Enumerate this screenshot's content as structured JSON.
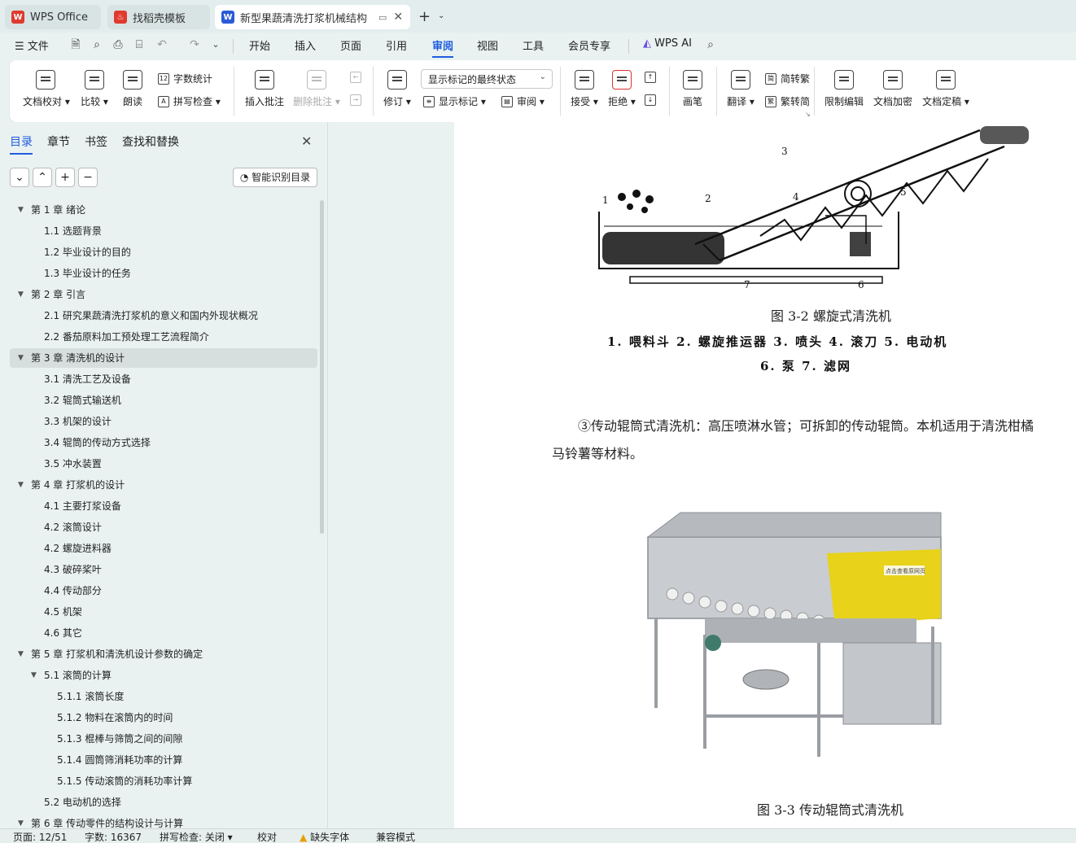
{
  "tabs": [
    {
      "label": "WPS Office",
      "icon": "wps-logo-icon",
      "color": "#e03a2f"
    },
    {
      "label": "找稻壳模板",
      "icon": "docer-icon",
      "color": "#e03a2f"
    },
    {
      "label": "新型果蔬清洗打浆机械结构",
      "icon": "writer-doc-icon",
      "color": "#2a5bd7"
    }
  ],
  "menu": {
    "file": "文件",
    "items": [
      "开始",
      "插入",
      "页面",
      "引用",
      "审阅",
      "视图",
      "工具",
      "会员专享"
    ],
    "active": "审阅",
    "ai": "WPS AI"
  },
  "ribbon": {
    "doc_check": "文档校对",
    "compare": "比较",
    "read_aloud": "朗读",
    "word_count": "字数统计",
    "spell_check": "拼写检查",
    "insert_comment": "插入批注",
    "delete_comment": "删除批注",
    "revise": "修订",
    "markup_combo": "显示标记的最终状态",
    "show_markup": "显示标记",
    "review": "审阅",
    "accept": "接受",
    "reject": "拒绝",
    "pen": "画笔",
    "translate": "翻译",
    "to_traditional": "简转繁",
    "to_simplified": "繁转简",
    "restrict_edit": "限制编辑",
    "encrypt": "文档加密",
    "finalize": "文档定稿"
  },
  "sidebar": {
    "tabs": [
      "目录",
      "章节",
      "书签",
      "查找和替换"
    ],
    "active_tab": "目录",
    "smart_toc": "智能识别目录",
    "toc": [
      {
        "text": "第 1 章  绪论",
        "level": 1,
        "expanded": true
      },
      {
        "text": "1.1 选题背景",
        "level": 2
      },
      {
        "text": "1.2  毕业设计的目的",
        "level": 2
      },
      {
        "text": "1.3  毕业设计的任务",
        "level": 2
      },
      {
        "text": "第 2 章  引言",
        "level": 1,
        "expanded": true
      },
      {
        "text": "2.1 研究果蔬清洗打浆机的意义和国内外现状概况",
        "level": 2
      },
      {
        "text": "2.2 番茄原料加工预处理工艺流程简介",
        "level": 2
      },
      {
        "text": "第 3 章  清洗机的设计",
        "level": 1,
        "expanded": true,
        "selected": true
      },
      {
        "text": "3.1 清洗工艺及设备",
        "level": 2
      },
      {
        "text": "3.2 辊筒式输送机",
        "level": 2
      },
      {
        "text": "3.3 机架的设计",
        "level": 2
      },
      {
        "text": "3.4 辊筒的传动方式选择",
        "level": 2
      },
      {
        "text": "3.5 冲水装置",
        "level": 2
      },
      {
        "text": "第 4 章  打浆机的设计",
        "level": 1,
        "expanded": true
      },
      {
        "text": "4.1 主要打浆设备",
        "level": 2
      },
      {
        "text": "4.2 滚筒设计",
        "level": 2
      },
      {
        "text": "4.2 螺旋进料器",
        "level": 2
      },
      {
        "text": "4.3 破碎桨叶",
        "level": 2
      },
      {
        "text": "4.4 传动部分",
        "level": 2
      },
      {
        "text": "4.5 机架",
        "level": 2
      },
      {
        "text": "4.6 其它",
        "level": 2
      },
      {
        "text": "第 5 章     打浆机和清洗机设计参数的确定",
        "level": 1,
        "expanded": true
      },
      {
        "text": "5.1 滚筒的计算",
        "level": 2,
        "expanded": true
      },
      {
        "text": "5.1.1 滚筒长度",
        "level": 3
      },
      {
        "text": "5.1.2 物料在滚筒内的时间",
        "level": 3
      },
      {
        "text": "5.1.3  棍棒与筛筒之间的间隙",
        "level": 3
      },
      {
        "text": "5.1.4 圆筒筛消耗功率的计算",
        "level": 3
      },
      {
        "text": "5.1.5 传动滚筒的消耗功率计算",
        "level": 3
      },
      {
        "text": "5.2 电动机的选择",
        "level": 2
      },
      {
        "text": "第 6 章  传动零件的结构设计与计算",
        "level": 1,
        "expanded": true
      }
    ]
  },
  "document": {
    "fig1_caption": "图 3-2 螺旋式清洗机",
    "fig1_legend_line1": "1. 喂料斗   2. 螺旋推运器   3. 喷头   4. 滚刀   5. 电动机",
    "fig1_legend_line2": "6. 泵   7. 滤网",
    "fig1_numbers": [
      "1",
      "2",
      "3",
      "4",
      "5",
      "6",
      "7"
    ],
    "para_line1": "③传动辊筒式清洗机：高压喷淋水管；可拆卸的传动辊筒。本机适用于清洗柑橘",
    "para_line2": "马铃薯等材料。",
    "fig2_watermark": "点击查看原网页",
    "fig2_caption": "图 3-3 传动辊筒式清洗机"
  },
  "status": {
    "page": "页面: 12/51",
    "words": "字数: 16367",
    "spell": "拼写检查: 关闭",
    "proof": "校对",
    "missing_font": "缺失字体",
    "compat": "兼容模式"
  }
}
